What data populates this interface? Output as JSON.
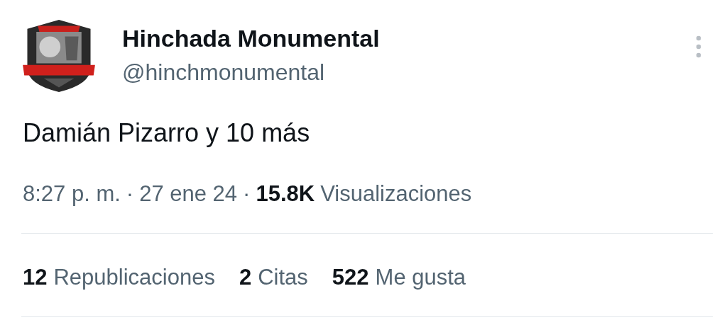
{
  "account": {
    "name": "Hinchada Monumental",
    "handle": "@hinchmonumental"
  },
  "post": {
    "text": "Damián Pizarro y 10 más"
  },
  "meta": [
    {
      "kind": "text",
      "text": "8:27 p. m."
    },
    {
      "kind": "sep",
      "text": "·"
    },
    {
      "kind": "text",
      "text": "27 ene 24"
    },
    {
      "kind": "sep",
      "text": "·"
    },
    {
      "kind": "strong",
      "text": "15.8K"
    },
    {
      "kind": "text",
      "text": "Visualizaciones"
    }
  ],
  "stats": [
    {
      "count": "12",
      "label": "Republicaciones"
    },
    {
      "count": "2",
      "label": "Citas"
    },
    {
      "count": "522",
      "label": "Me gusta"
    }
  ]
}
